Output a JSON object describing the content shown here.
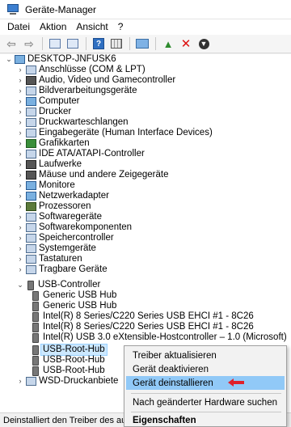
{
  "window": {
    "title": "Geräte-Manager"
  },
  "menu": [
    "Datei",
    "Aktion",
    "Ansicht",
    "?"
  ],
  "toolbar": {
    "back_icon": "back-arrow-icon",
    "forward_icon": "forward-arrow-icon"
  },
  "tree": {
    "root": "DESKTOP-JNFUSK6",
    "categories": [
      "Anschlüsse (COM & LPT)",
      "Audio, Video und Gamecontroller",
      "Bildverarbeitungsgeräte",
      "Computer",
      "Drucker",
      "Druckwarteschlangen",
      "Eingabegeräte (Human Interface Devices)",
      "Grafikkarten",
      "IDE ATA/ATAPI-Controller",
      "Laufwerke",
      "Mäuse und andere Zeigegeräte",
      "Monitore",
      "Netzwerkadapter",
      "Prozessoren",
      "Softwaregeräte",
      "Softwarekomponenten",
      "Speichercontroller",
      "Systemgeräte",
      "Tastaturen",
      "Tragbare Geräte"
    ],
    "usb_label": "USB-Controller",
    "usb_children": [
      "Generic USB Hub",
      "Generic USB Hub",
      "Intel(R) 8 Series/C220 Series USB EHCI #1 - 8C26",
      "Intel(R) 8 Series/C220 Series USB EHCI #1 - 8C26",
      "Intel(R) USB 3.0 eXtensible-Hostcontroller – 1.0 (Microsoft)",
      "USB-Root-Hub",
      "USB-Root-Hub",
      "USB-Root-Hub"
    ],
    "wsd_label": "WSD-Druckanbiete"
  },
  "context_menu": {
    "items": [
      "Treiber aktualisieren",
      "Gerät deaktivieren",
      "Gerät deinstallieren",
      "Nach geänderter Hardware suchen",
      "Eigenschaften"
    ],
    "highlight_color": "#91c9f7",
    "arrow_color": "#e0202a"
  },
  "status": {
    "text": "Deinstalliert den Treiber des au"
  }
}
